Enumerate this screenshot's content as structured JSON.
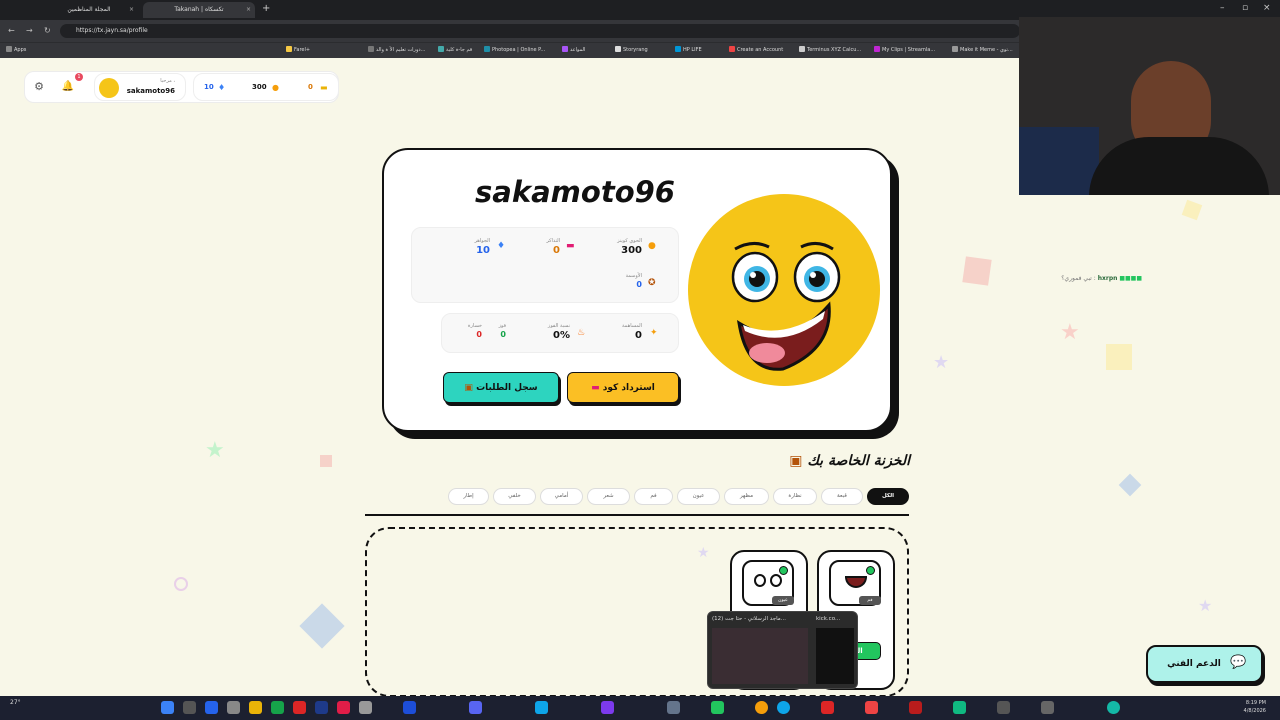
{
  "browser": {
    "tabs": [
      {
        "label": "المجلة المناظمين"
      },
      {
        "label": "Takanah | تكسكاه"
      }
    ],
    "url": "https://tx.jayn.sa/profile",
    "bookmarks": [
      "Apps",
      "Farel+",
      "دورات تعليم الأ ة والذ...",
      "قم جا-ة كلية",
      "Photopea | Online P...",
      "المواعد",
      "Storyrang",
      "HP LIFE",
      "Create an Account",
      "Terminus XYZ Calcu...",
      "My Clips | Streamla...",
      "Make it Meme - توي..."
    ]
  },
  "header": {
    "greeting": "مرحبا ،",
    "username": "sakamoto96",
    "notif_count": "1",
    "gems": "10",
    "coins": "300",
    "tickets": "0"
  },
  "profile": {
    "title": "sakamoto96",
    "stats": {
      "coins_label": "الحوي كوينز",
      "coins_value": "300",
      "tickets_label": "التذاكر",
      "tickets_value": "0",
      "gems_label": "الجواهر",
      "gems_value": "10",
      "badges_label": "الأوسمة",
      "badges_value": "0"
    },
    "stats2": {
      "contrib_label": "المساهمة",
      "contrib_value": "0",
      "winrate_label": "نسبة الفوز",
      "winrate_value": "0%",
      "wins_label": "فوز",
      "wins_value": "0",
      "losses_label": "خسارة",
      "losses_value": "0"
    },
    "redeem_label": "استرداد كود",
    "orders_label": "سجل الطلبات"
  },
  "inventory": {
    "title": "الخزنة الخاصة بك",
    "filters": [
      "الكل",
      "قبعة",
      "نظارة",
      "مظهر",
      "عيون",
      "فم",
      "شعر",
      "أمامي",
      "خلفي",
      "إطار"
    ],
    "items": [
      {
        "tag": "فم",
        "partial_label": "بق",
        "button": "الف"
      },
      {
        "tag": "عيون"
      }
    ]
  },
  "stream_chat": {
    "user": "hxrpn",
    "text": "تبي فموري؟ :"
  },
  "taskbar_preview": {
    "items": [
      "(12) ماجد الرسلاني - حتا جت...",
      "kick.co..."
    ]
  },
  "support": {
    "label": "الدعم الفني"
  },
  "system": {
    "weather": "27°",
    "time": "8:19 PM",
    "date": "4/8/2026"
  }
}
